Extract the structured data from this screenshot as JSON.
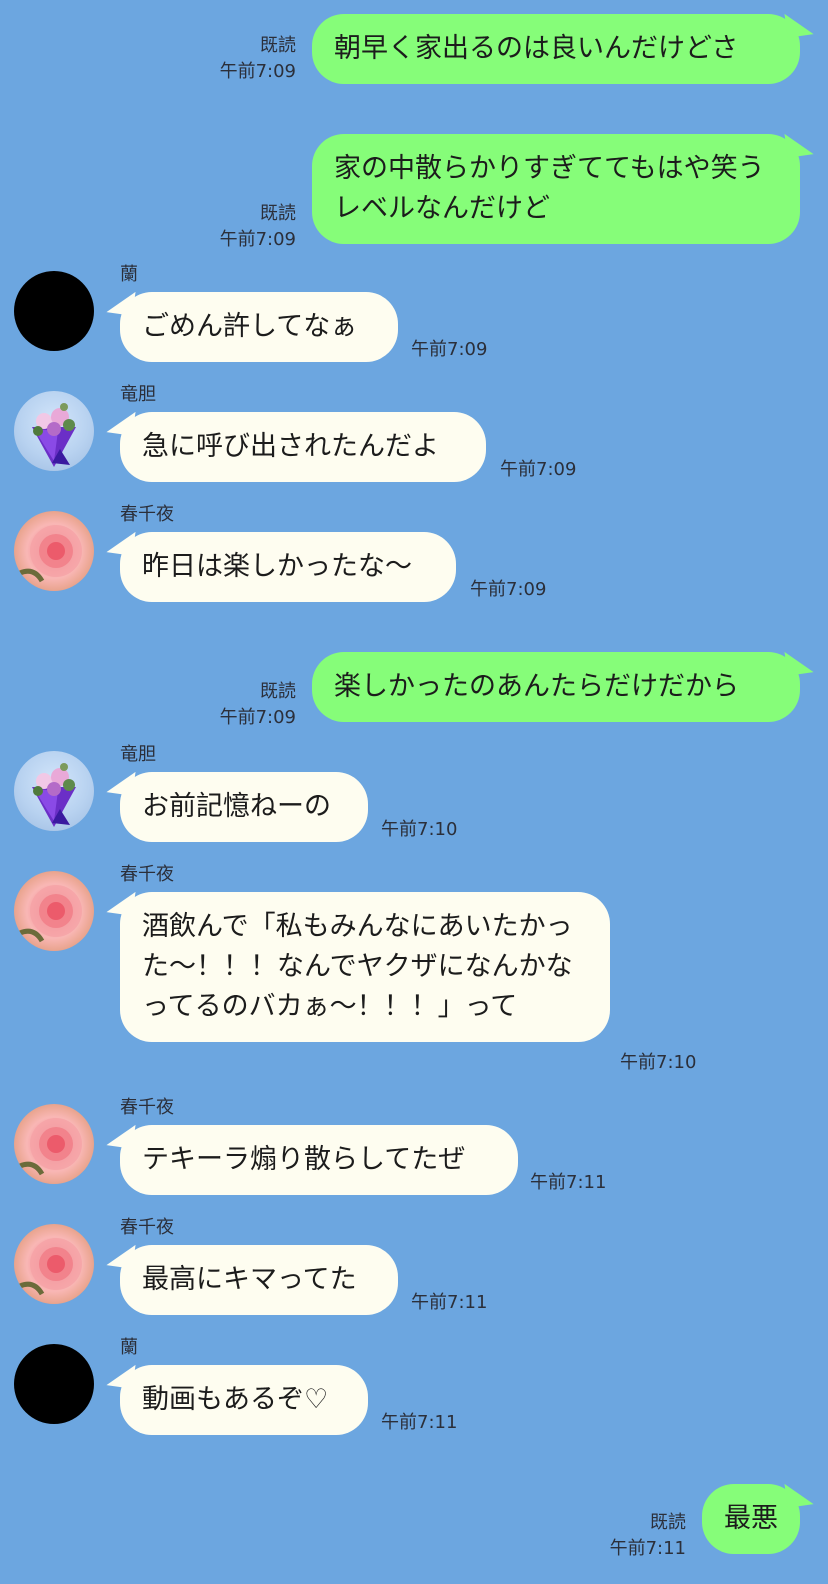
{
  "messages": [
    {
      "dir": "out",
      "text": "朝早く家出るのは良いんだけどさ",
      "read": "既読",
      "time": "午前7:09"
    },
    {
      "dir": "out",
      "text": "家の中散らかりすぎててもはや笑うレベルなんだけど",
      "read": "既読",
      "time": "午前7:09"
    },
    {
      "dir": "in",
      "sender": "蘭",
      "text": "ごめん許してなぁ",
      "time": "午前7:09"
    },
    {
      "dir": "in",
      "sender": "竜胆",
      "text": "急に呼び出されたんだよ",
      "time": "午前7:09"
    },
    {
      "dir": "in",
      "sender": "春千夜",
      "text": "昨日は楽しかったな〜",
      "time": "午前7:09"
    },
    {
      "dir": "out",
      "text": "楽しかったのあんたらだけだから",
      "read": "既読",
      "time": "午前7:09"
    },
    {
      "dir": "in",
      "sender": "竜胆",
      "text": "お前記憶ねーの",
      "time": "午前7:10"
    },
    {
      "dir": "in",
      "sender": "春千夜",
      "text": "酒飲んで「私もみんなにあいたかった〜！！！なんでヤクザになんかなってるのバカぁ〜！！！」って",
      "time": "午前7:10"
    },
    {
      "dir": "in",
      "sender": "春千夜",
      "text": "テキーラ煽り散らしてたぜ",
      "time": "午前7:11"
    },
    {
      "dir": "in",
      "sender": "春千夜",
      "text": "最高にキマってた",
      "time": "午前7:11"
    },
    {
      "dir": "in",
      "sender": "蘭",
      "text": "動画もあるぞ♡",
      "time": "午前7:11"
    },
    {
      "dir": "out",
      "text": "最悪",
      "read": "既読",
      "time": "午前7:11"
    }
  ],
  "avatars": {
    "蘭": "black-circle",
    "竜胆": "purple-bouquet",
    "春千夜": "pink-rose"
  },
  "colors": {
    "background": "#6ca6e0",
    "outgoing_bubble": "#86fd79",
    "incoming_bubble": "#fefdf0"
  }
}
